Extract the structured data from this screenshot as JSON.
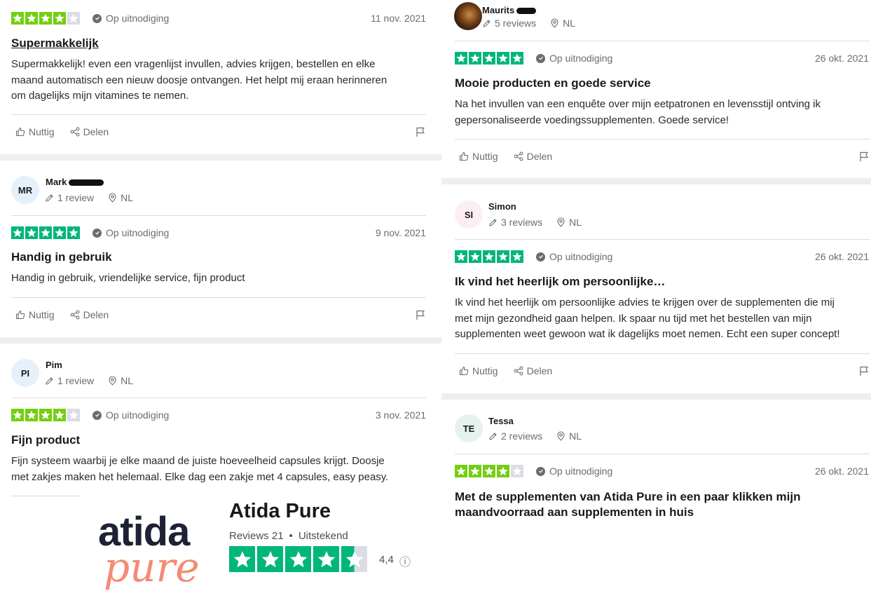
{
  "colors": {
    "star_green": "#00b67a",
    "star_4_green": "#73cf11",
    "star_empty": "#dcdce6",
    "avatar_blue": "#e5f0fb",
    "avatar_pink": "#fdeef3",
    "avatar_mint": "#e5f2ef",
    "logo_dark": "#1d2234",
    "logo_salmon": "#f48b72"
  },
  "icons": {
    "helpful": "thumbs-up-icon",
    "share": "share-icon",
    "flag": "flag-icon",
    "reviews": "pencil-icon",
    "location": "location-pin-icon",
    "verified": "check-circle-icon"
  },
  "labels": {
    "helpful": "Nuttig",
    "share": "Delen",
    "verified": "Op uitnodiging"
  },
  "reviews_left": [
    {
      "rating": 4,
      "date": "11 nov. 2021",
      "title": "Supermakkelijk",
      "body": [
        "Supermakkelijk! even een vragenlijst invullen, advies krijgen, bestellen en elke",
        "maand automatisch een nieuw doosje ontvangen. Het helpt mij eraan herinneren",
        "om dagelijks mijn vitamines te nemen."
      ]
    },
    {
      "user": {
        "initials": "MR",
        "name": "Mark",
        "reviews": "1 review",
        "country": "NL"
      },
      "rating": 5,
      "date": "9 nov. 2021",
      "title": "Handig in gebruik",
      "body": [
        "Handig in gebruik, vriendelijke service, fijn product"
      ]
    },
    {
      "user": {
        "initials": "PI",
        "name": "Pim",
        "reviews": "1 review",
        "country": "NL"
      },
      "rating": 4,
      "date": "3 nov. 2021",
      "title": "Fijn product",
      "body": [
        "Fijn systeem waarbij je elke maand de juiste hoeveelheid capsules krijgt. Doosje",
        "met zakjes maken het helemaal. Elke dag een zakje met 4 capsules, easy peasy."
      ]
    }
  ],
  "reviews_right": [
    {
      "user": {
        "name": "Maurits",
        "reviews": "5 reviews",
        "country": "NL"
      },
      "rating": 5,
      "date": "26 okt. 2021",
      "title": "Mooie producten en goede service",
      "body": [
        "Na het invullen van een enquête over mijn eetpatronen en levensstijl ontving ik",
        "gepersonaliseerde voedingssupplementen. Goede service!"
      ]
    },
    {
      "user": {
        "initials": "SI",
        "name": "Simon",
        "reviews": "3 reviews",
        "country": "NL"
      },
      "rating": 5,
      "date": "26 okt. 2021",
      "title": "Ik vind het heerlijk om persoonlijke…",
      "body": [
        "Ik vind het heerlijk om persoonlijke advies te krijgen over de supplementen die mij",
        "met mijn gezondheid gaan helpen. Ik spaar nu tijd met het bestellen van mijn",
        "supplementen weet gewoon wat ik dagelijks moet nemen. Echt een super concept!"
      ]
    },
    {
      "user": {
        "initials": "TE",
        "name": "Tessa",
        "reviews": "2 reviews",
        "country": "NL"
      },
      "rating": 4,
      "date": "26 okt. 2021",
      "title": "Met de supplementen van Atida Pure in een paar klikken mijn maandvoorraad aan supplementen in huis",
      "title_lines": [
        "Met de supplementen van Atida Pure in een paar klikken mijn",
        "maandvoorraad aan supplementen in huis"
      ]
    }
  ],
  "brand": {
    "logo_top": "atida",
    "logo_bottom": "pure",
    "name": "Atida Pure",
    "reviews_label": "Reviews 21",
    "bullet": "•",
    "verdict": "Uitstekend",
    "score": "4,4",
    "rating": 4.5,
    "info": "ⓘ"
  }
}
